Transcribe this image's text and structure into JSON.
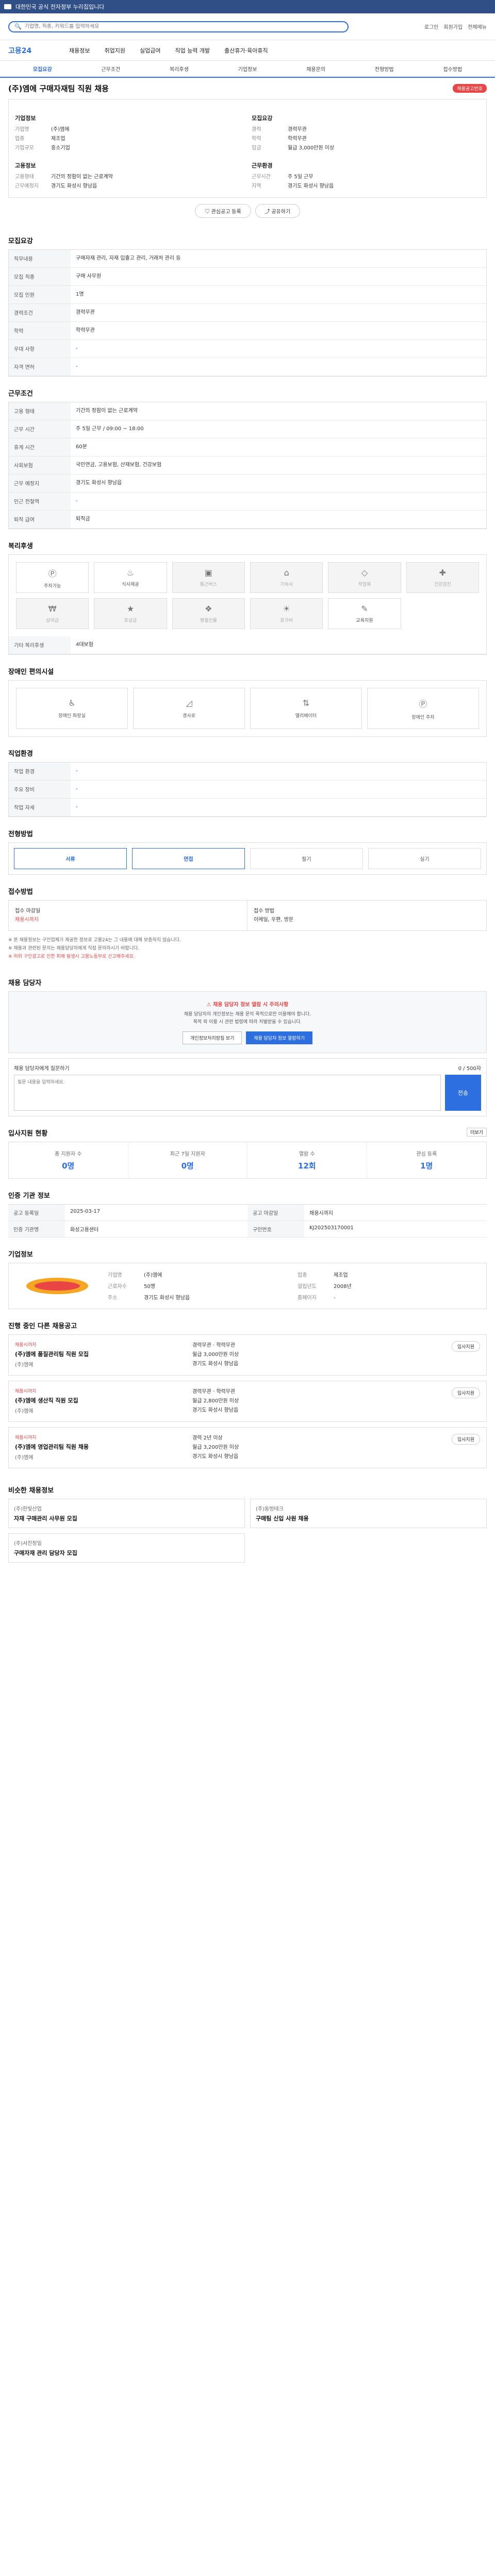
{
  "topbar": {
    "text": "대한민국 공식 전자정부 누리집입니다"
  },
  "search": {
    "placeholder": "기업명, 직종, 키워드를 입력하세요",
    "login": "로그인",
    "signup": "회원가입",
    "sitemap": "전체메뉴"
  },
  "gnb": {
    "logo": "고용24",
    "items": [
      "채용정보",
      "취업지원",
      "실업급여",
      "직업 능력 개발",
      "출산휴가·육아휴직"
    ]
  },
  "subtabs": [
    "모집요강",
    "근무조건",
    "복리후생",
    "기업정보",
    "채용문의",
    "전형방법",
    "접수방법"
  ],
  "title": "(주)엠에 구매자재팀 직원 채용",
  "status_badge": "채용공고번호",
  "summary": {
    "left_title": "기업정보",
    "left": [
      {
        "k": "기업명",
        "v": "(주)엠에"
      },
      {
        "k": "업종",
        "v": "제조업"
      },
      {
        "k": "기업규모",
        "v": "중소기업"
      }
    ],
    "left_title2": "고용정보",
    "left2": [
      {
        "k": "고용형태",
        "v": "기간의 정함이 없는 근로계약"
      },
      {
        "k": "근무예정지",
        "v": "경기도 화성시 향남읍"
      }
    ],
    "right_title": "모집요강",
    "right": [
      {
        "k": "경력",
        "v": "경력무관"
      },
      {
        "k": "학력",
        "v": "학력무관"
      },
      {
        "k": "임금",
        "v": "월급 3,000만원 이상"
      }
    ],
    "right_title2": "근무환경",
    "right2": [
      {
        "k": "근무시간",
        "v": "주 5일 근무"
      },
      {
        "k": "지역",
        "v": "경기도 화성시 향남읍"
      }
    ]
  },
  "actions": {
    "scrap": "관심공고 등록",
    "share": "공유하기"
  },
  "recruit": {
    "h": "모집요강",
    "rows": [
      {
        "k": "직무내용",
        "v": "구매자재 관리, 자재 입출고 관리, 거래처 관리 등"
      },
      {
        "k": "모집 직종",
        "v": "구매 사무원"
      },
      {
        "k": "모집 인원",
        "v": "1명"
      },
      {
        "k": "경력조건",
        "v": "경력무관"
      },
      {
        "k": "학력",
        "v": "학력무관"
      },
      {
        "k": "우대 사항",
        "v": "-"
      },
      {
        "k": "자격 면허",
        "v": "-"
      }
    ]
  },
  "work": {
    "h": "근무조건",
    "rows": [
      {
        "k": "고용 형태",
        "v": "기간의 정함이 없는 근로계약"
      },
      {
        "k": "근무 시간",
        "v": "주 5일 근무 / 09:00 ~ 18:00"
      },
      {
        "k": "휴게 시간",
        "v": "60분"
      },
      {
        "k": "사회보험",
        "v": "국민연금, 고용보험, 산재보험, 건강보험"
      },
      {
        "k": "근무 예정지",
        "v": "경기도 화성시 향남읍"
      },
      {
        "k": "인근 전철역",
        "v": "-"
      },
      {
        "k": "퇴직 급여",
        "v": "퇴직금"
      }
    ]
  },
  "welfare": {
    "h": "복리후생",
    "items": [
      {
        "icon": "parking-icon",
        "label": "주차가능"
      },
      {
        "icon": "meal-icon",
        "label": "식사제공"
      },
      {
        "icon": "bus-icon",
        "label": "통근버스"
      },
      {
        "icon": "dorm-icon",
        "label": "기숙사"
      },
      {
        "icon": "uniform-icon",
        "label": "작업복"
      },
      {
        "icon": "health-icon",
        "label": "건강검진"
      },
      {
        "icon": "bonus-icon",
        "label": "상여금"
      },
      {
        "icon": "award-icon",
        "label": "포상금"
      },
      {
        "icon": "gift-icon",
        "label": "명절선물"
      },
      {
        "icon": "vacation-icon",
        "label": "휴가비"
      },
      {
        "icon": "edu-icon",
        "label": "교육지원"
      }
    ],
    "extra_k": "기타 복리후생",
    "extra_v": "4대보험"
  },
  "facility": {
    "h": "장애인 편의시설",
    "items": [
      {
        "icon": "wheelchair-icon",
        "label": "장애인 화장실"
      },
      {
        "icon": "ramp-icon",
        "label": "경사로"
      },
      {
        "icon": "elevator-icon",
        "label": "엘리베이터"
      },
      {
        "icon": "parking-icon",
        "label": "장애인 주차"
      }
    ]
  },
  "company_env": {
    "h": "직업환경",
    "rows": [
      {
        "k": "작업 환경",
        "v": "-"
      },
      {
        "k": "주요 장비",
        "v": "-"
      },
      {
        "k": "작업 자세",
        "v": "-"
      }
    ]
  },
  "method": {
    "h": "전형방법",
    "tabs": [
      "서류",
      "면접",
      "필기",
      "실기"
    ]
  },
  "apply": {
    "h": "접수방법",
    "left_title": "접수 마감일",
    "left_v": "채용시까지",
    "right_title": "접수 방법",
    "right_v": "이메일, 우편, 방문"
  },
  "notes": [
    "※ 본 채용정보는 구인업체가 제공한 정보로 고용24는 그 내용에 대해 보증하지 않습니다.",
    "※ 채용과 관련된 문의는 채용담당자에게 직접 문의하시기 바랍니다.",
    "※ 허위 구인광고로 인한 피해 발생시 고용노동부로 신고해주세요."
  ],
  "manager": {
    "h": "채용 담당자",
    "ok": "채용 담당자 정보 열람 시 주의사항",
    "p1": "채용 담당자의 개인정보는 채용 문의 목적으로만 이용해야 합니다.",
    "p2": "목적 외 이용 시 관련 법령에 따라 처벌받을 수 있습니다.",
    "btn1": "개인정보처리방침 보기",
    "btn2": "채용 담당자 정보 열람하기",
    "inq_title": "채용 담당자에게 질문하기",
    "inq_count": "0 / 500자",
    "inq_placeholder": "질문 내용을 입력하세요.",
    "send": "전송"
  },
  "stats": {
    "h": "입사지원 현황",
    "items": [
      {
        "lbl": "총 지원자 수",
        "num": "0명"
      },
      {
        "lbl": "최근 7일 지원자",
        "num": "0명"
      },
      {
        "lbl": "열람 수",
        "num": "12회"
      },
      {
        "lbl": "관심 등록",
        "num": "1명"
      }
    ]
  },
  "info": {
    "h": "인증 기관 정보",
    "rows": [
      {
        "k": "공고 등록일",
        "v": "2025-03-17"
      },
      {
        "k": "공고 마감일",
        "v": "채용시까지"
      },
      {
        "k": "인증 기관명",
        "v": "화성고용센터"
      },
      {
        "k": "구인번호",
        "v": "KJ202503170001"
      }
    ]
  },
  "company": {
    "h": "기업정보",
    "rows": [
      {
        "k": "기업명",
        "v": "(주)엠에"
      },
      {
        "k": "업종",
        "v": "제조업"
      },
      {
        "k": "근로자수",
        "v": "50명"
      },
      {
        "k": "설립년도",
        "v": "2008년"
      },
      {
        "k": "주소",
        "v": "경기도 화성시 향남읍"
      },
      {
        "k": "홈페이지",
        "v": "-"
      }
    ]
  },
  "jobs": {
    "h": "진행 중인 다른 채용공고",
    "items": [
      {
        "st": "채용시까지",
        "t": "(주)엠에 품질관리팀 직원 모집",
        "c": "(주)엠에",
        "m1": "경력무관 · 학력무관",
        "m2": "월급 3,000만원 이상",
        "m3": "경기도 화성시 향남읍",
        "chip": "입사지원"
      },
      {
        "st": "채용시까지",
        "t": "(주)엠에 생산직 직원 모집",
        "c": "(주)엠에",
        "m1": "경력무관 · 학력무관",
        "m2": "월급 2,800만원 이상",
        "m3": "경기도 화성시 향남읍",
        "chip": "입사지원"
      },
      {
        "st": "채용시까지",
        "t": "(주)엠에 영업관리팀 직원 채용",
        "c": "(주)엠에",
        "m1": "경력 2년 이상",
        "m2": "월급 3,200만원 이상",
        "m3": "경기도 화성시 향남읍",
        "chip": "입사지원"
      }
    ]
  },
  "related": {
    "h": "비슷한 채용정보",
    "items": [
      {
        "co": "(주)한빛산업",
        "t": "자재 구매관리 사무원 모집"
      },
      {
        "co": "(주)동방테크",
        "t": "구매팀 신입 사원 채용"
      },
      {
        "co": "(주)서진정밀",
        "t": "구매자재 관리 담당자 모집"
      }
    ]
  },
  "more": "더보기"
}
